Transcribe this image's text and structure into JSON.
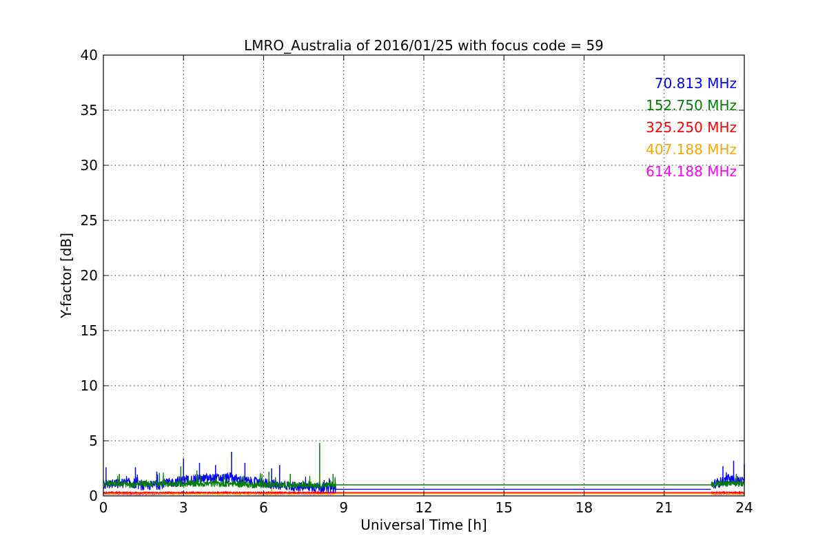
{
  "chart_data": {
    "type": "line",
    "title": "LMRO_Australia of 2016/01/25 with focus code = 59",
    "xlabel": "Universal Time [h]",
    "ylabel": "Y-factor [dB]",
    "xlim": [
      0,
      24
    ],
    "ylim": [
      0,
      40
    ],
    "xticks": [
      "0",
      "3",
      "6",
      "9",
      "12",
      "15",
      "18",
      "21",
      "24"
    ],
    "yticks": [
      "0",
      "5",
      "10",
      "15",
      "20",
      "25",
      "30",
      "35",
      "40"
    ],
    "grid": true,
    "legend_position": "top-right",
    "series": [
      {
        "name": "70.813 MHz",
        "color": "#0000ff",
        "x": [
          0,
          0.5,
          1.0,
          1.5,
          2.0,
          2.5,
          3.0,
          3.5,
          4.0,
          4.5,
          4.8,
          5.0,
          5.5,
          6.0,
          6.5,
          7.0,
          7.5,
          8.0,
          8.5,
          8.7,
          22.75,
          23.0,
          23.5,
          24.0
        ],
        "y": [
          1.0,
          1.1,
          1.2,
          0.9,
          1.0,
          1.2,
          1.4,
          1.5,
          1.6,
          1.6,
          1.7,
          1.5,
          1.3,
          1.2,
          1.0,
          0.9,
          0.8,
          0.8,
          0.7,
          0.7,
          0.9,
          1.2,
          1.5,
          1.3
        ],
        "peaks": [
          [
            0.1,
            2.6
          ],
          [
            1.2,
            2.6
          ],
          [
            2.0,
            2.2
          ],
          [
            3.0,
            3.4
          ],
          [
            3.6,
            3.0
          ],
          [
            4.2,
            2.8
          ],
          [
            4.8,
            4.0
          ],
          [
            5.3,
            3.0
          ],
          [
            6.3,
            2.5
          ],
          [
            6.6,
            2.8
          ],
          [
            23.2,
            2.7
          ],
          [
            23.6,
            3.2
          ],
          [
            24.0,
            2.9
          ]
        ],
        "gap_level": 0.6
      },
      {
        "name": "152.750 MHz",
        "color": "#008000",
        "x": [
          0,
          0.5,
          1.0,
          1.5,
          2.0,
          2.5,
          3.0,
          3.5,
          4.0,
          4.5,
          5.0,
          5.5,
          6.0,
          6.5,
          7.0,
          7.5,
          8.0,
          8.5,
          8.7,
          22.75,
          23.0,
          23.5,
          24.0
        ],
        "y": [
          1.1,
          1.1,
          1.0,
          1.1,
          1.1,
          1.1,
          1.1,
          1.1,
          1.1,
          1.1,
          1.1,
          1.0,
          1.0,
          1.0,
          1.0,
          1.0,
          1.0,
          1.0,
          1.0,
          1.0,
          1.1,
          1.1,
          1.1
        ],
        "peaks": [
          [
            0.6,
            2.0
          ],
          [
            2.1,
            2.1
          ],
          [
            2.9,
            2.7
          ],
          [
            3.5,
            2.3
          ],
          [
            4.5,
            2.0
          ],
          [
            6.2,
            2.2
          ],
          [
            7.0,
            2.0
          ],
          [
            8.1,
            4.8
          ],
          [
            8.6,
            2.0
          ],
          [
            23.7,
            2.0
          ]
        ],
        "gap_level": 1.0
      },
      {
        "name": "325.250 MHz",
        "color": "#ff0000",
        "x": [
          0,
          8.7,
          22.75,
          24.0
        ],
        "y": [
          0.3,
          0.3,
          0.3,
          0.3
        ],
        "peaks": [],
        "gap_level": 0.3
      },
      {
        "name": "407.188 MHz",
        "color": "#ffa500",
        "x": [
          0,
          8.7,
          22.75,
          24.0
        ],
        "y": [
          0.2,
          0.2,
          0.2,
          0.2
        ],
        "peaks": [
          [
            6.3,
            1.2
          ]
        ],
        "gap_level": 0.2
      },
      {
        "name": "614.188 MHz",
        "color": "#ff00ff",
        "x": [
          0,
          1.5,
          3.0,
          4.5,
          6.0,
          7.5,
          8.7,
          22.75,
          24.0
        ],
        "y": [
          0.2,
          0.15,
          0.25,
          0.25,
          0.2,
          0.2,
          0.2,
          0.2,
          0.2
        ],
        "peaks": [],
        "gap_level": 0.2
      }
    ]
  }
}
